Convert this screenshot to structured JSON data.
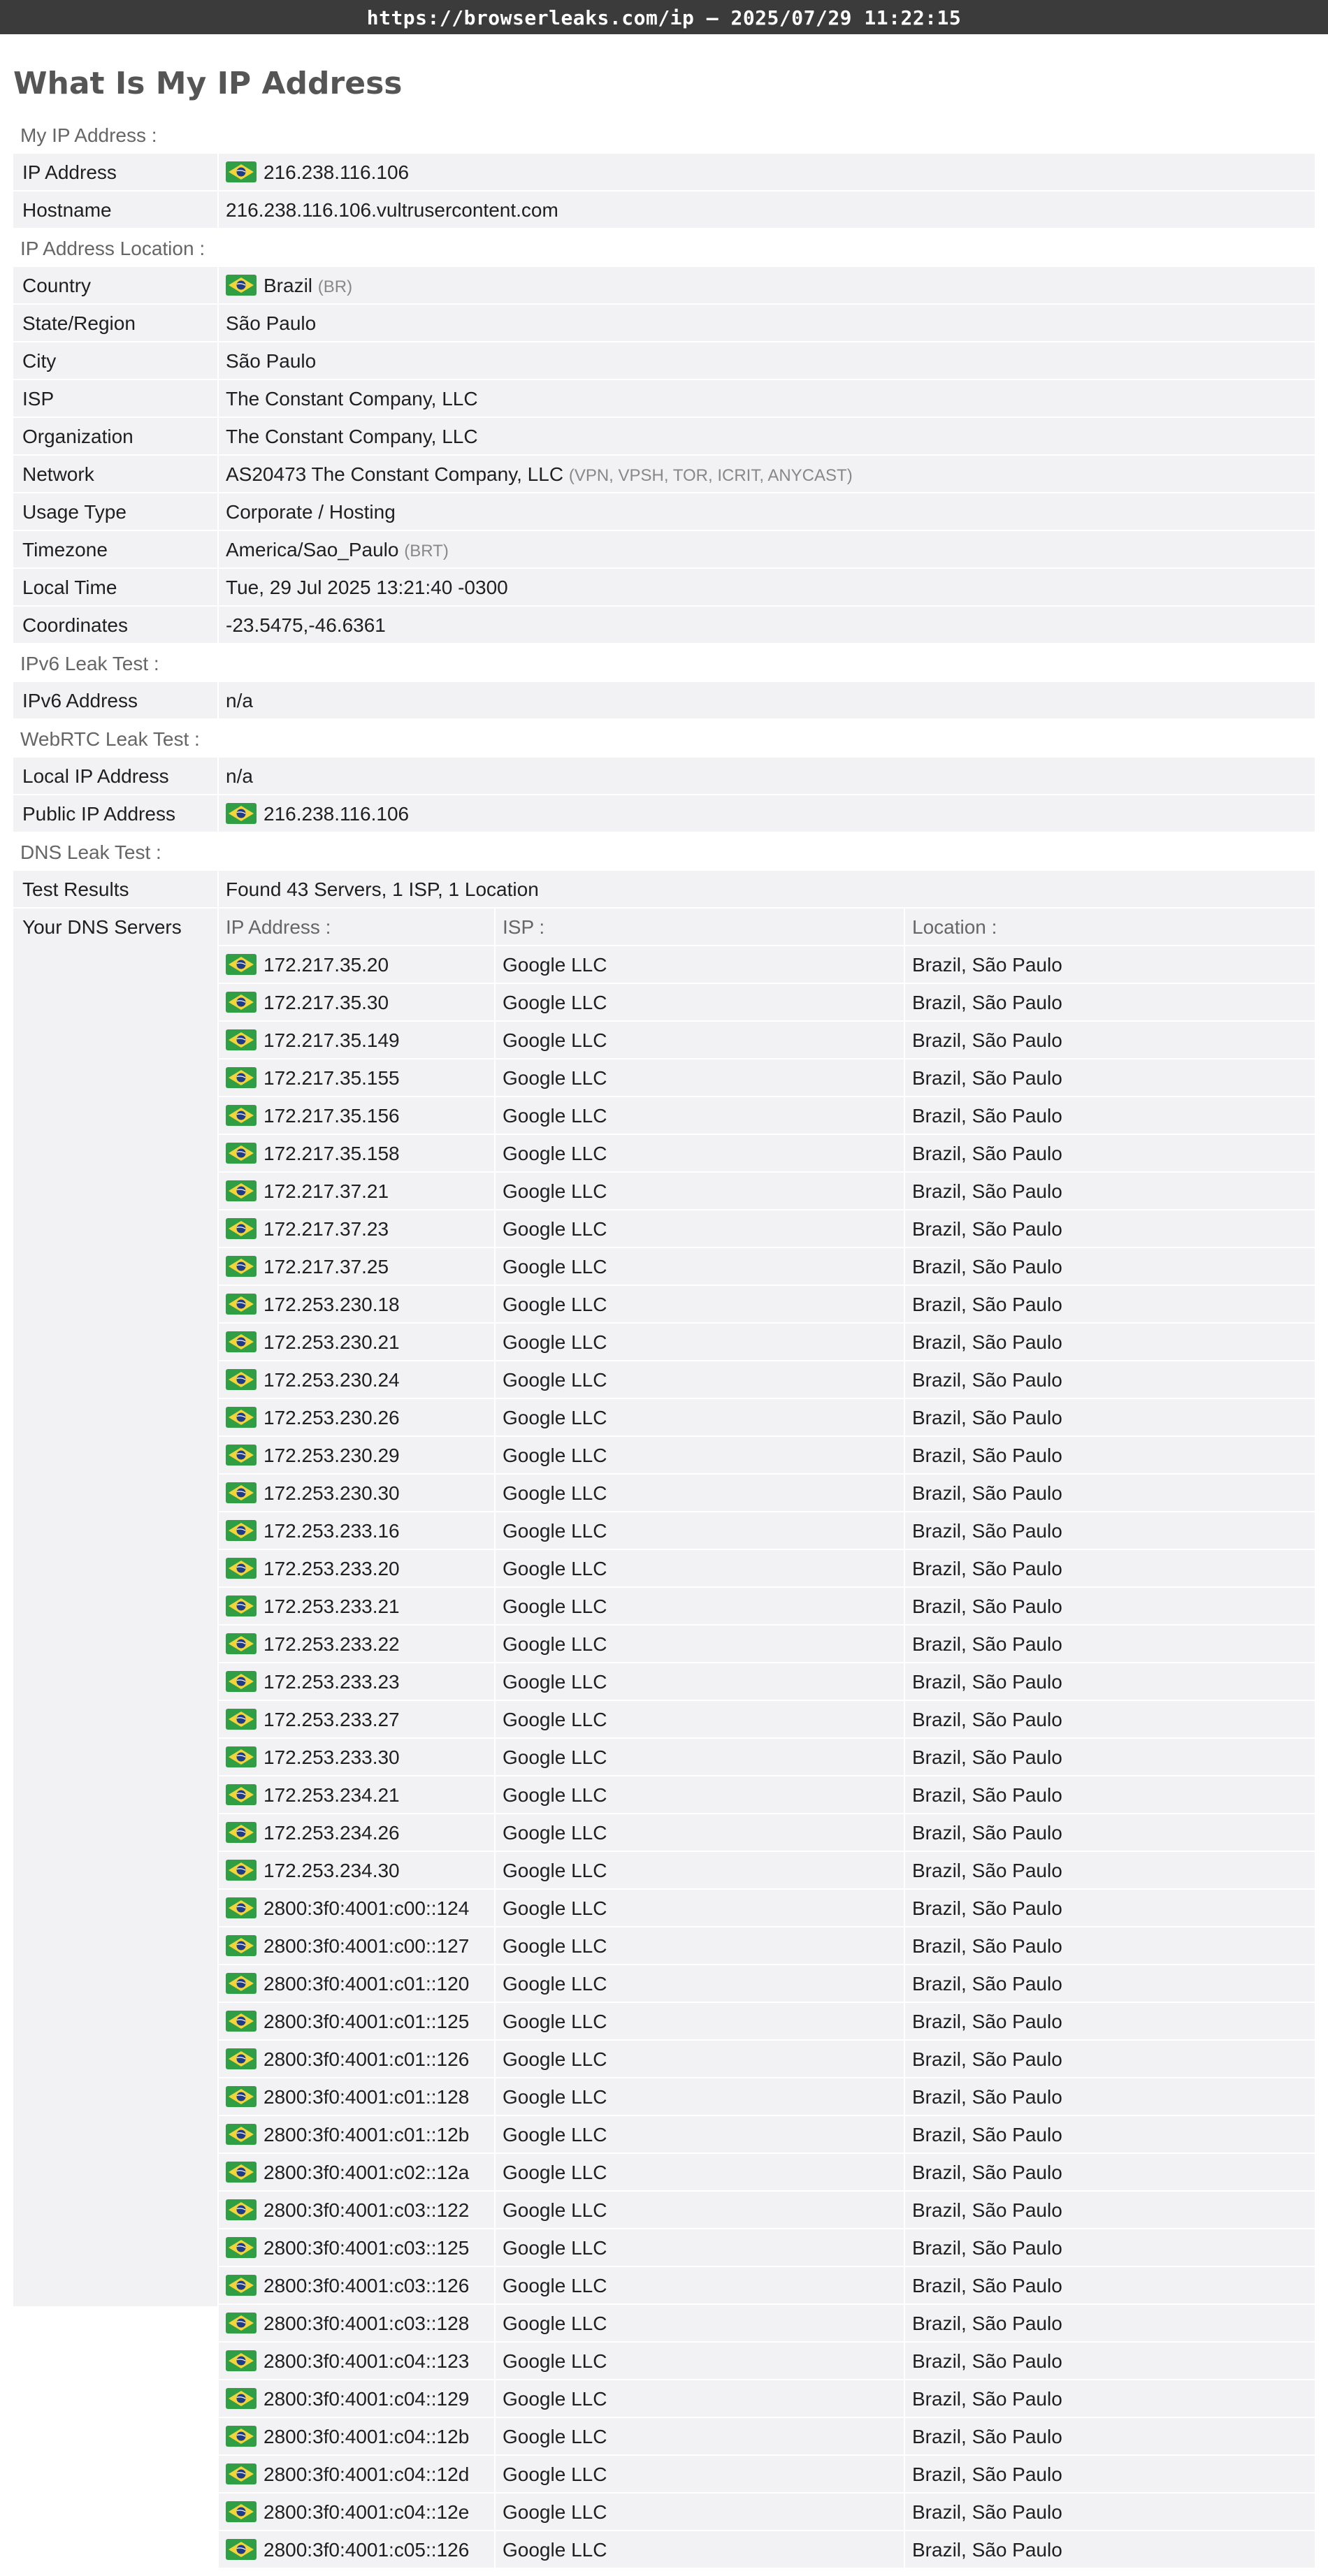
{
  "topbar": {
    "text": "https://browserleaks.com/ip – 2025/07/29 11:22:15"
  },
  "page_title": "What Is My IP Address",
  "colors": {
    "flag_green": "#2f9e44",
    "flag_yellow": "#f2d43b",
    "flag_blue": "#1f3c88"
  },
  "flag_icon": "brazil-flag-icon",
  "sections": [
    {
      "title": "My IP Address :",
      "rows": [
        {
          "label": "IP Address",
          "value": "216.238.116.106",
          "flag": true
        },
        {
          "label": "Hostname",
          "value": "216.238.116.106.vultrusercontent.com"
        }
      ]
    },
    {
      "title": "IP Address Location :",
      "rows": [
        {
          "label": "Country",
          "value": "Brazil",
          "note": "(BR)",
          "flag": true
        },
        {
          "label": "State/Region",
          "value": "São Paulo"
        },
        {
          "label": "City",
          "value": "São Paulo"
        },
        {
          "label": "ISP",
          "value": "The Constant Company, LLC"
        },
        {
          "label": "Organization",
          "value": "The Constant Company, LLC"
        },
        {
          "label": "Network",
          "value": "AS20473 The Constant Company, LLC",
          "note": "(VPN, VPSH, TOR, ICRIT, ANYCAST)"
        },
        {
          "label": "Usage Type",
          "value": "Corporate / Hosting"
        },
        {
          "label": "Timezone",
          "value": "America/Sao_Paulo",
          "note": "(BRT)"
        },
        {
          "label": "Local Time",
          "value": "Tue, 29 Jul 2025 13:21:40 -0300"
        },
        {
          "label": "Coordinates",
          "value": "-23.5475,-46.6361"
        }
      ]
    },
    {
      "title": "IPv6 Leak Test :",
      "rows": [
        {
          "label": "IPv6 Address",
          "value": "n/a"
        }
      ]
    },
    {
      "title": "WebRTC Leak Test :",
      "rows": [
        {
          "label": "Local IP Address",
          "value": "n/a"
        },
        {
          "label": "Public IP Address",
          "value": "216.238.116.106",
          "flag": true
        }
      ]
    }
  ],
  "dns": {
    "title": "DNS Leak Test :",
    "test_results_label": "Test Results",
    "test_results_value": "Found 43 Servers, 1 ISP, 1 Location",
    "servers_label": "Your DNS Servers",
    "headers": {
      "ip": "IP Address :",
      "isp": "ISP :",
      "location": "Location :"
    },
    "servers": [
      {
        "ip": "172.217.35.20",
        "isp": "Google LLC",
        "location": "Brazil, São Paulo"
      },
      {
        "ip": "172.217.35.30",
        "isp": "Google LLC",
        "location": "Brazil, São Paulo"
      },
      {
        "ip": "172.217.35.149",
        "isp": "Google LLC",
        "location": "Brazil, São Paulo"
      },
      {
        "ip": "172.217.35.155",
        "isp": "Google LLC",
        "location": "Brazil, São Paulo"
      },
      {
        "ip": "172.217.35.156",
        "isp": "Google LLC",
        "location": "Brazil, São Paulo"
      },
      {
        "ip": "172.217.35.158",
        "isp": "Google LLC",
        "location": "Brazil, São Paulo"
      },
      {
        "ip": "172.217.37.21",
        "isp": "Google LLC",
        "location": "Brazil, São Paulo"
      },
      {
        "ip": "172.217.37.23",
        "isp": "Google LLC",
        "location": "Brazil, São Paulo"
      },
      {
        "ip": "172.217.37.25",
        "isp": "Google LLC",
        "location": "Brazil, São Paulo"
      },
      {
        "ip": "172.253.230.18",
        "isp": "Google LLC",
        "location": "Brazil, São Paulo"
      },
      {
        "ip": "172.253.230.21",
        "isp": "Google LLC",
        "location": "Brazil, São Paulo"
      },
      {
        "ip": "172.253.230.24",
        "isp": "Google LLC",
        "location": "Brazil, São Paulo"
      },
      {
        "ip": "172.253.230.26",
        "isp": "Google LLC",
        "location": "Brazil, São Paulo"
      },
      {
        "ip": "172.253.230.29",
        "isp": "Google LLC",
        "location": "Brazil, São Paulo"
      },
      {
        "ip": "172.253.230.30",
        "isp": "Google LLC",
        "location": "Brazil, São Paulo"
      },
      {
        "ip": "172.253.233.16",
        "isp": "Google LLC",
        "location": "Brazil, São Paulo"
      },
      {
        "ip": "172.253.233.20",
        "isp": "Google LLC",
        "location": "Brazil, São Paulo"
      },
      {
        "ip": "172.253.233.21",
        "isp": "Google LLC",
        "location": "Brazil, São Paulo"
      },
      {
        "ip": "172.253.233.22",
        "isp": "Google LLC",
        "location": "Brazil, São Paulo"
      },
      {
        "ip": "172.253.233.23",
        "isp": "Google LLC",
        "location": "Brazil, São Paulo"
      },
      {
        "ip": "172.253.233.27",
        "isp": "Google LLC",
        "location": "Brazil, São Paulo"
      },
      {
        "ip": "172.253.233.30",
        "isp": "Google LLC",
        "location": "Brazil, São Paulo"
      },
      {
        "ip": "172.253.234.21",
        "isp": "Google LLC",
        "location": "Brazil, São Paulo"
      },
      {
        "ip": "172.253.234.26",
        "isp": "Google LLC",
        "location": "Brazil, São Paulo"
      },
      {
        "ip": "172.253.234.30",
        "isp": "Google LLC",
        "location": "Brazil, São Paulo"
      },
      {
        "ip": "2800:3f0:4001:c00::124",
        "isp": "Google LLC",
        "location": "Brazil, São Paulo"
      },
      {
        "ip": "2800:3f0:4001:c00::127",
        "isp": "Google LLC",
        "location": "Brazil, São Paulo"
      },
      {
        "ip": "2800:3f0:4001:c01::120",
        "isp": "Google LLC",
        "location": "Brazil, São Paulo"
      },
      {
        "ip": "2800:3f0:4001:c01::125",
        "isp": "Google LLC",
        "location": "Brazil, São Paulo"
      },
      {
        "ip": "2800:3f0:4001:c01::126",
        "isp": "Google LLC",
        "location": "Brazil, São Paulo"
      },
      {
        "ip": "2800:3f0:4001:c01::128",
        "isp": "Google LLC",
        "location": "Brazil, São Paulo"
      },
      {
        "ip": "2800:3f0:4001:c01::12b",
        "isp": "Google LLC",
        "location": "Brazil, São Paulo"
      },
      {
        "ip": "2800:3f0:4001:c02::12a",
        "isp": "Google LLC",
        "location": "Brazil, São Paulo"
      },
      {
        "ip": "2800:3f0:4001:c03::122",
        "isp": "Google LLC",
        "location": "Brazil, São Paulo"
      },
      {
        "ip": "2800:3f0:4001:c03::125",
        "isp": "Google LLC",
        "location": "Brazil, São Paulo"
      },
      {
        "ip": "2800:3f0:4001:c03::126",
        "isp": "Google LLC",
        "location": "Brazil, São Paulo"
      },
      {
        "ip": "2800:3f0:4001:c03::128",
        "isp": "Google LLC",
        "location": "Brazil, São Paulo"
      },
      {
        "ip": "2800:3f0:4001:c04::123",
        "isp": "Google LLC",
        "location": "Brazil, São Paulo"
      },
      {
        "ip": "2800:3f0:4001:c04::129",
        "isp": "Google LLC",
        "location": "Brazil, São Paulo"
      },
      {
        "ip": "2800:3f0:4001:c04::12b",
        "isp": "Google LLC",
        "location": "Brazil, São Paulo"
      },
      {
        "ip": "2800:3f0:4001:c04::12d",
        "isp": "Google LLC",
        "location": "Brazil, São Paulo"
      },
      {
        "ip": "2800:3f0:4001:c04::12e",
        "isp": "Google LLC",
        "location": "Brazil, São Paulo"
      },
      {
        "ip": "2800:3f0:4001:c05::126",
        "isp": "Google LLC",
        "location": "Brazil, São Paulo"
      }
    ]
  }
}
